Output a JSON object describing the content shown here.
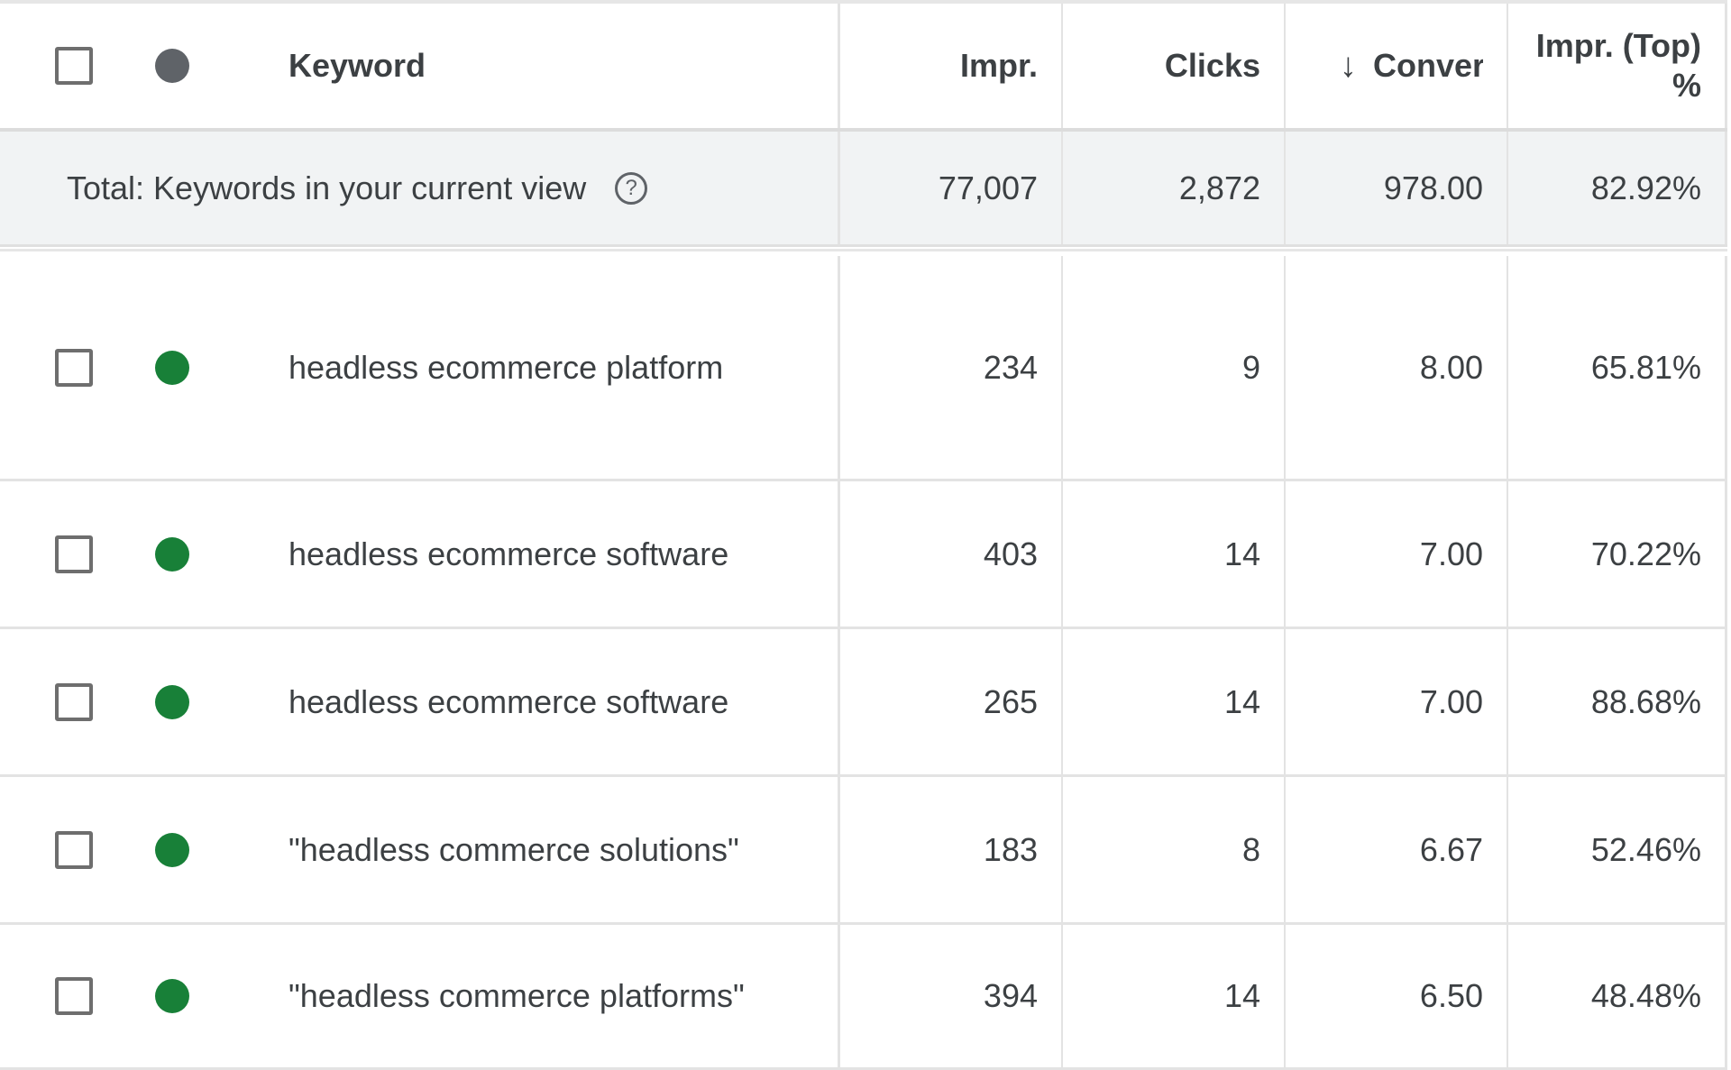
{
  "header": {
    "keyword": "Keyword",
    "impr": "Impr.",
    "clicks": "Clicks",
    "sort_icon": "↓",
    "conversions": "Conversions",
    "impr_top_line1": "Impr. (Top)",
    "impr_top_line2": "%"
  },
  "total": {
    "label": "Total: Keywords in your current view",
    "help_icon": "?",
    "impr": "77,007",
    "clicks": "2,872",
    "conversions": "978.00",
    "impr_top": "82.92%"
  },
  "rows": [
    {
      "keyword": "headless ecommerce platform",
      "impr": "234",
      "clicks": "9",
      "conversions": "8.00",
      "impr_top": "65.81%",
      "status": "enabled"
    },
    {
      "keyword": "headless ecommerce software",
      "impr": "403",
      "clicks": "14",
      "conversions": "7.00",
      "impr_top": "70.22%",
      "status": "enabled"
    },
    {
      "keyword": "headless ecommerce software",
      "impr": "265",
      "clicks": "14",
      "conversions": "7.00",
      "impr_top": "88.68%",
      "status": "enabled"
    },
    {
      "keyword": "\"headless commerce solutions\"",
      "impr": "183",
      "clicks": "8",
      "conversions": "6.67",
      "impr_top": "52.46%",
      "status": "enabled"
    },
    {
      "keyword": "\"headless commerce platforms\"",
      "impr": "394",
      "clicks": "14",
      "conversions": "6.50",
      "impr_top": "48.48%",
      "status": "enabled"
    }
  ],
  "colors": {
    "status_enabled": "#188038",
    "status_header": "#5f6368",
    "total_row_bg": "#f1f3f4"
  }
}
